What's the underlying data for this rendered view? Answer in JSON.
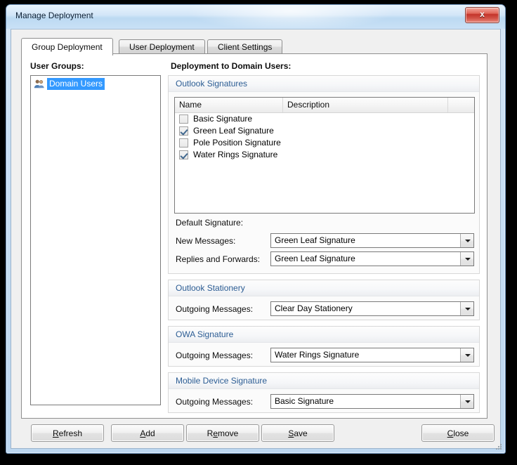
{
  "window": {
    "title": "Manage Deployment",
    "close_label": "x",
    "close_icon": "close-x-icon"
  },
  "tabs": [
    {
      "label": "Group Deployment",
      "active": true
    },
    {
      "label": "User Deployment",
      "active": false
    },
    {
      "label": "Client Settings",
      "active": false
    }
  ],
  "left_panel": {
    "label": "User Groups:",
    "items": [
      {
        "label": "Domain Users",
        "selected": true,
        "icon": "users-group-icon"
      }
    ]
  },
  "right_panel": {
    "label": "Deployment to Domain Users:",
    "outlook_signatures": {
      "header": "Outlook Signatures",
      "columns": [
        "Name",
        "Description",
        ""
      ],
      "rows": [
        {
          "name": "Basic Signature",
          "description": "",
          "checked": false
        },
        {
          "name": "Green Leaf Signature",
          "description": "",
          "checked": true
        },
        {
          "name": "Pole Position Signature",
          "description": "",
          "checked": false
        },
        {
          "name": "Water Rings Signature",
          "description": "",
          "checked": true
        }
      ],
      "default_signature_label": "Default Signature:",
      "fields": [
        {
          "label": "New Messages:",
          "value": "Green Leaf Signature"
        },
        {
          "label": "Replies and Forwards:",
          "value": "Green Leaf Signature"
        }
      ]
    },
    "outlook_stationery": {
      "header": "Outlook Stationery",
      "fields": [
        {
          "label": "Outgoing Messages:",
          "value": "Clear Day Stationery"
        }
      ]
    },
    "owa_signature": {
      "header": "OWA Signature",
      "fields": [
        {
          "label": "Outgoing Messages:",
          "value": "Water Rings Signature"
        }
      ]
    },
    "mobile_device_signature": {
      "header": "Mobile Device Signature",
      "fields": [
        {
          "label": "Outgoing Messages:",
          "value": "Basic Signature"
        }
      ]
    }
  },
  "buttons": [
    {
      "label": "Refresh",
      "accel": "R"
    },
    {
      "label": "Add",
      "accel": "A"
    },
    {
      "label": "Remove",
      "accel": "e"
    },
    {
      "label": "Save",
      "accel": "S"
    },
    {
      "label": "Close",
      "accel": "C"
    }
  ],
  "colors": {
    "accent_group_header": "#2b5c93",
    "selection_blue": "#3399ff",
    "checkmark": "#41688f",
    "close_button_red": "#c3342a",
    "window_frame": "#bdd7f0"
  }
}
